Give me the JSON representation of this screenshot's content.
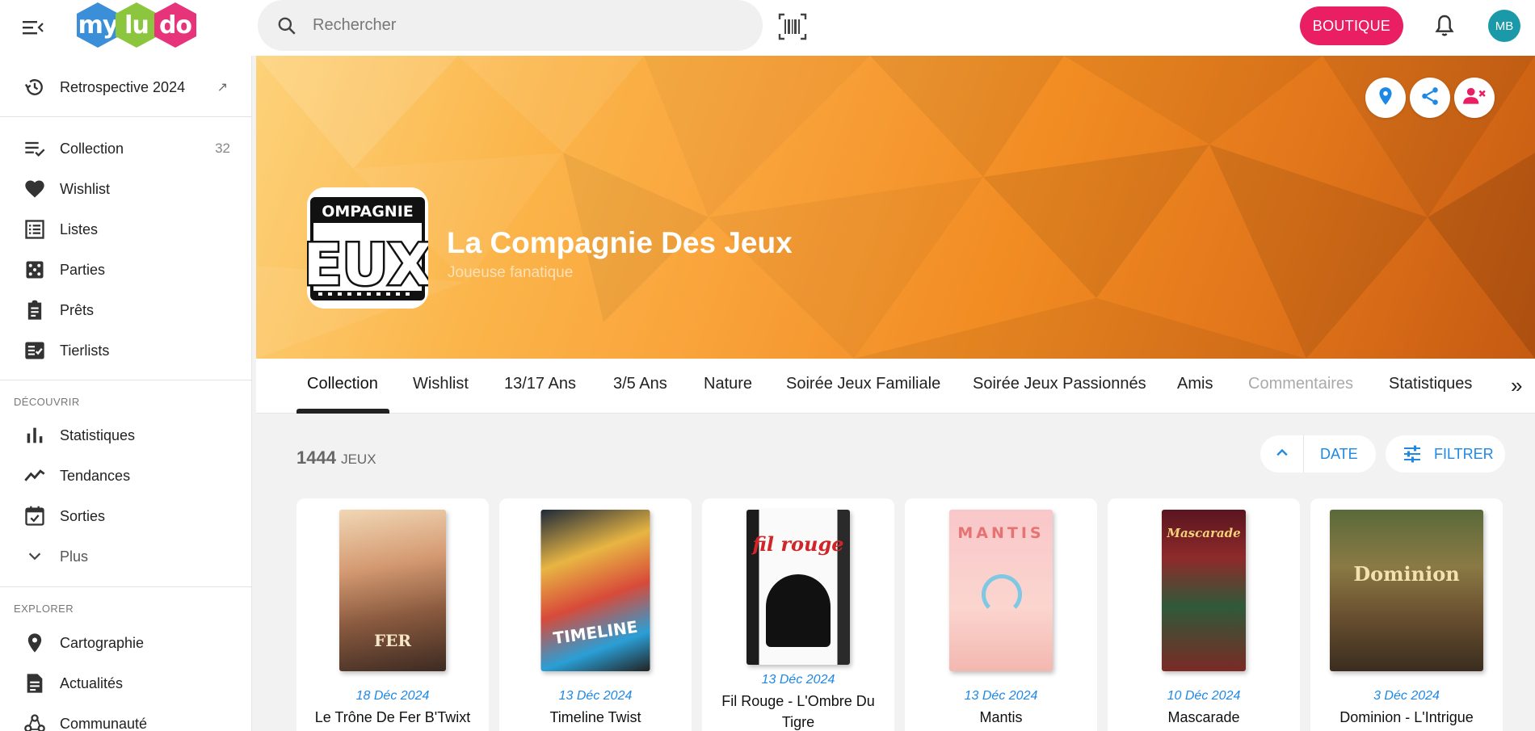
{
  "header": {
    "logo_letters": [
      "my",
      "lu",
      "do"
    ],
    "search_placeholder": "Rechercher",
    "shop_label": "BOUTIQUE",
    "avatar_initials": "MB",
    "brand_color": "#e91e63"
  },
  "sidebar": {
    "retro": {
      "label": "Retrospective 2024",
      "icon": "history-icon"
    },
    "items": [
      {
        "label": "Collection",
        "count": "32",
        "icon": "playlist-check-icon"
      },
      {
        "label": "Wishlist",
        "icon": "heart-icon"
      },
      {
        "label": "Listes",
        "icon": "list-icon"
      },
      {
        "label": "Parties",
        "icon": "dice-icon"
      },
      {
        "label": "Prêts",
        "icon": "clipboard-icon"
      },
      {
        "label": "Tierlists",
        "icon": "checklist-icon"
      }
    ],
    "discover_title": "DÉCOUVRIR",
    "discover": [
      {
        "label": "Statistiques",
        "icon": "bar-chart-icon"
      },
      {
        "label": "Tendances",
        "icon": "trending-icon"
      },
      {
        "label": "Sorties",
        "icon": "calendar-check-icon"
      },
      {
        "label": "Plus",
        "icon": "chevron-down-icon"
      }
    ],
    "explore_title": "EXPLORER",
    "explore": [
      {
        "label": "Cartographie",
        "icon": "map-pin-icon"
      },
      {
        "label": "Actualités",
        "icon": "article-icon"
      },
      {
        "label": "Communauté",
        "icon": "community-icon"
      }
    ]
  },
  "profile": {
    "name": "La Compagnie Des Jeux",
    "subtitle": "Joueuse fanatique",
    "logo_text_top": "OMPAGNIE",
    "logo_text_main": "EUX"
  },
  "tabs": [
    {
      "label": "Collection",
      "state": "active"
    },
    {
      "label": "Wishlist"
    },
    {
      "label": "13/17 Ans"
    },
    {
      "label": "3/5 Ans"
    },
    {
      "label": "Nature"
    },
    {
      "label": "Soirée Jeux Familiale"
    },
    {
      "label": "Soirée Jeux Passionnés"
    },
    {
      "label": "Amis"
    },
    {
      "label": "Commentaires",
      "state": "disabled"
    },
    {
      "label": "Statistiques"
    }
  ],
  "collection": {
    "count": "1444",
    "unit": "JEUX",
    "sort_label": "DATE",
    "filter_label": "FILTRER",
    "accent_color": "#1e88e5"
  },
  "games": [
    {
      "date": "18 Déc 2024",
      "title": "Le Trône De Fer B'Twixt",
      "box_text": "FER"
    },
    {
      "date": "13 Déc 2024",
      "title": "Timeline Twist",
      "box_text": "TIMELINE"
    },
    {
      "date": "13 Déc 2024",
      "title": "Fil Rouge - L'Ombre Du Tigre",
      "box_text": "fil rouge"
    },
    {
      "date": "13 Déc 2024",
      "title": "Mantis",
      "box_text": "MANTIS"
    },
    {
      "date": "10 Déc 2024",
      "title": "Mascarade",
      "box_text": "Mascarade"
    },
    {
      "date": "3 Déc 2024",
      "title": "Dominion - L'Intrigue",
      "box_text": "Dominion"
    }
  ]
}
